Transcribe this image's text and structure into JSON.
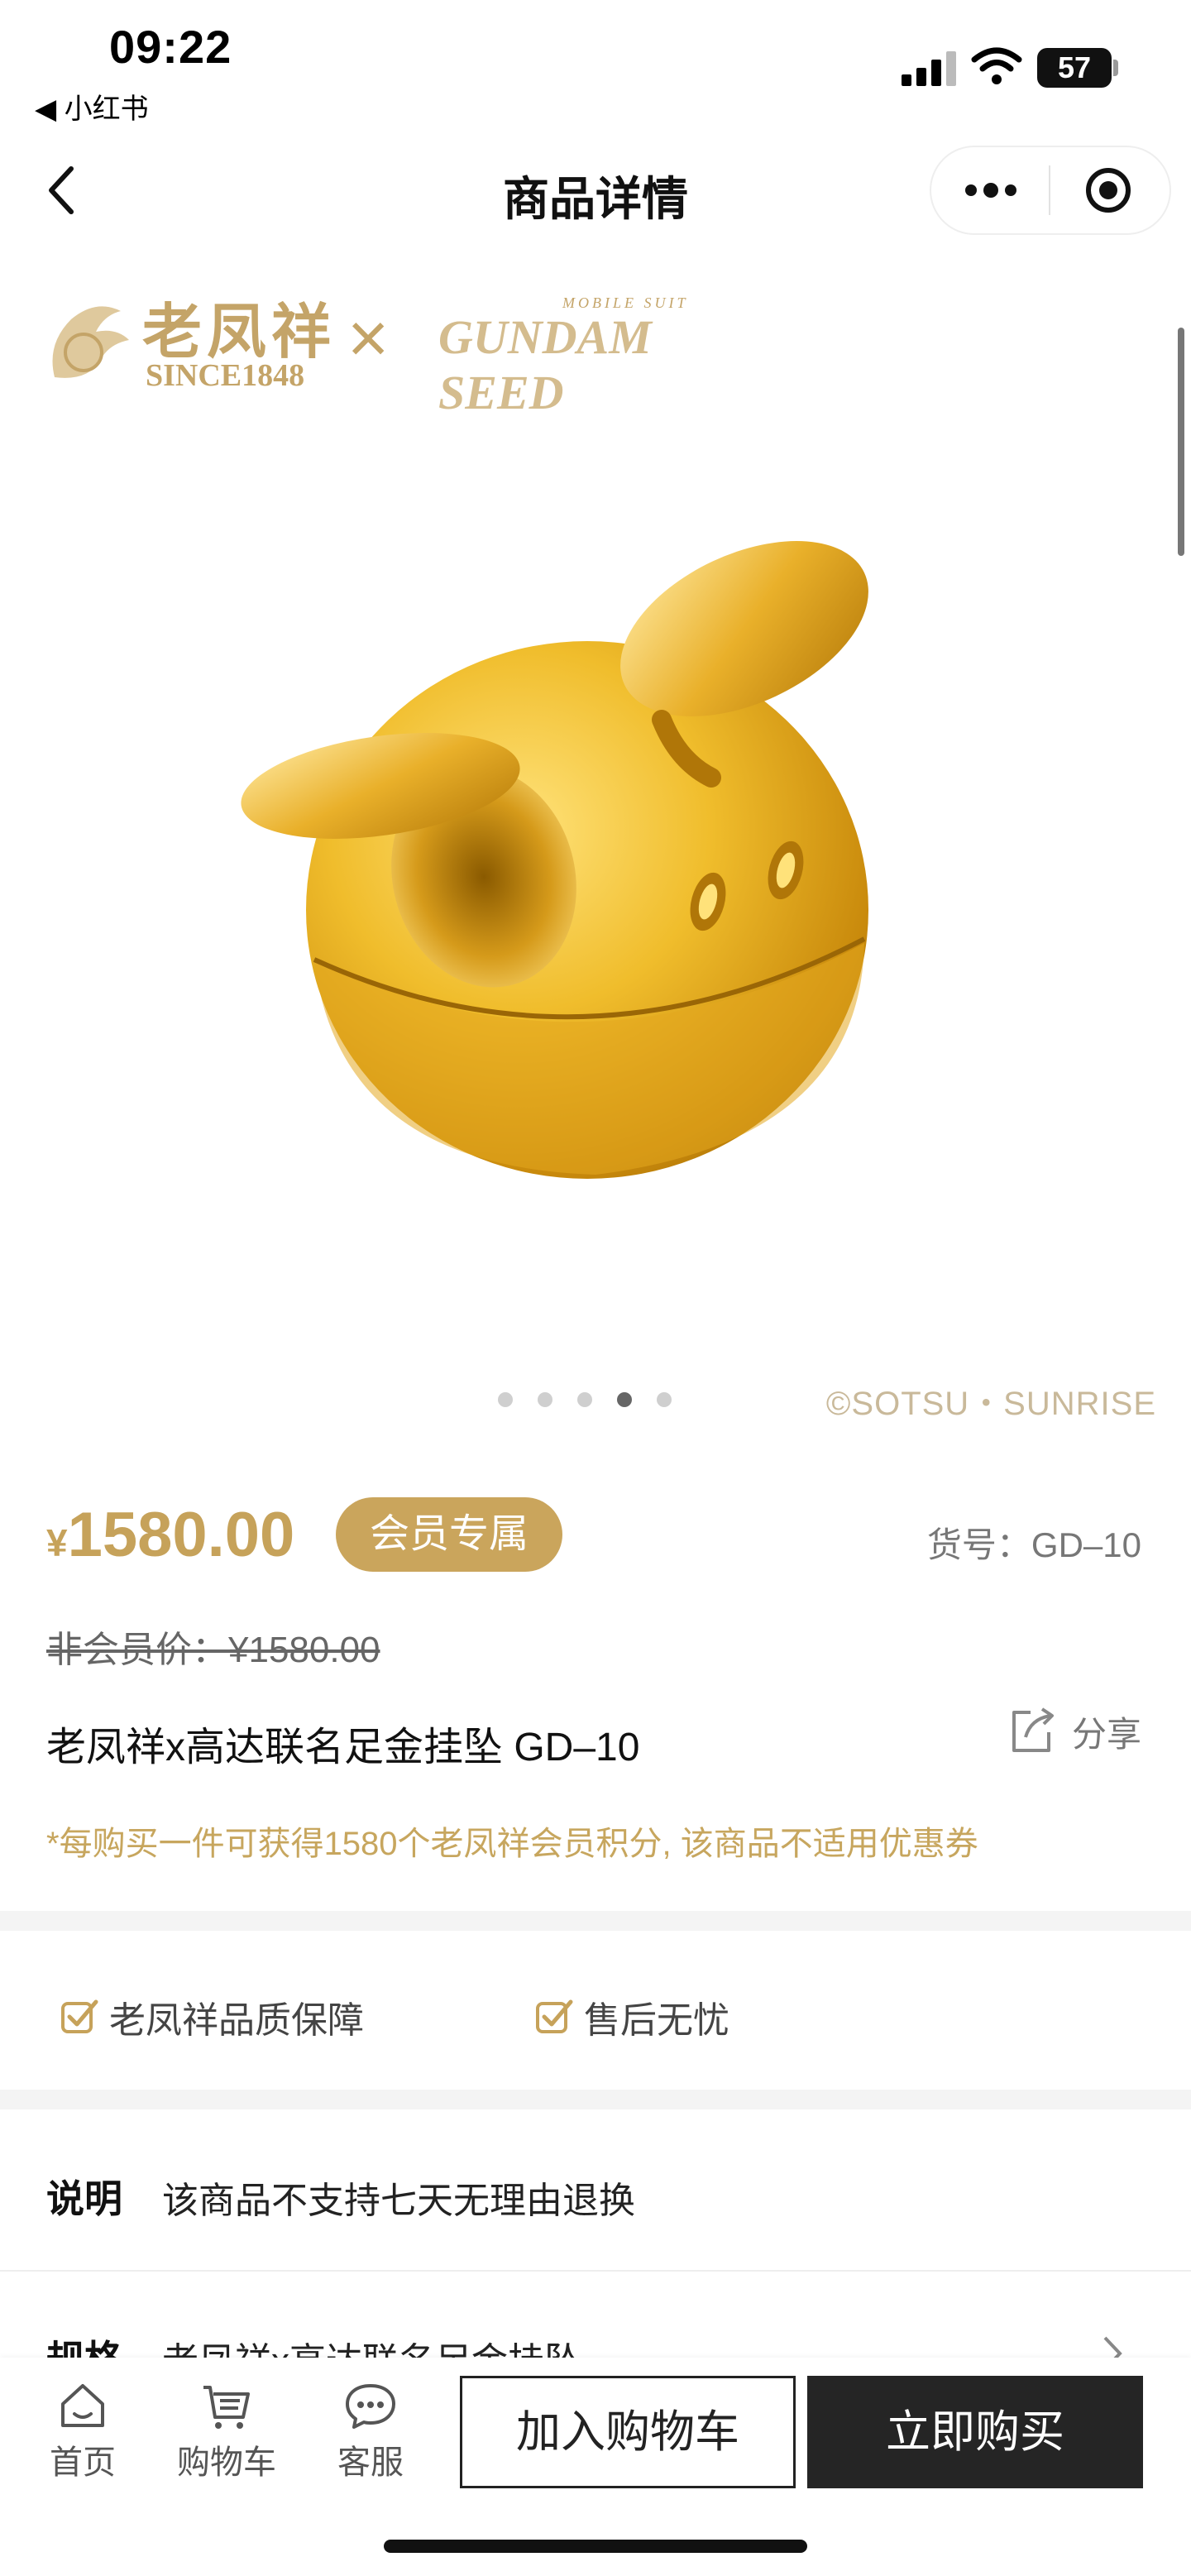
{
  "status_bar": {
    "time": "09:22",
    "back_app": "◀ 小红书",
    "battery": "57"
  },
  "nav": {
    "title": "商品详情"
  },
  "banner": {
    "brand_cn": "老凤祥",
    "brand_since": "SINCE1848",
    "times": "×",
    "collab_small": "MOBILE SUIT",
    "collab_name": "GUNDAM SEED"
  },
  "gallery": {
    "copyright": "©SOTSU・SUNRISE",
    "dots_count": 5,
    "active_index": 3
  },
  "product": {
    "currency": "¥",
    "price": "1580.00",
    "member_badge": "会员专属",
    "sku": "货号：GD–10",
    "nonmember_price": "非会员价：¥1580.00",
    "name": "老凤祥x高达联名足金挂坠 GD–10",
    "share": "分享",
    "points_note": "*每购买一件可获得1580个老凤祥会员积分, 该商品不适用优惠券"
  },
  "assurances": [
    "老凤祥品质保障",
    "售后无忧"
  ],
  "info_rows": [
    {
      "label": "说明",
      "text": "该商品不支持七天无理由退换"
    },
    {
      "label": "规格",
      "text": "老凤祥x高达联名足金挂坠"
    }
  ],
  "bottom_bar": {
    "tabs": [
      "首页",
      "购物车",
      "客服"
    ],
    "add_to_cart": "加入购物车",
    "buy_now": "立即购买"
  },
  "colors": {
    "accent_gold": "#c6a25a",
    "buy_button": "#252525"
  }
}
